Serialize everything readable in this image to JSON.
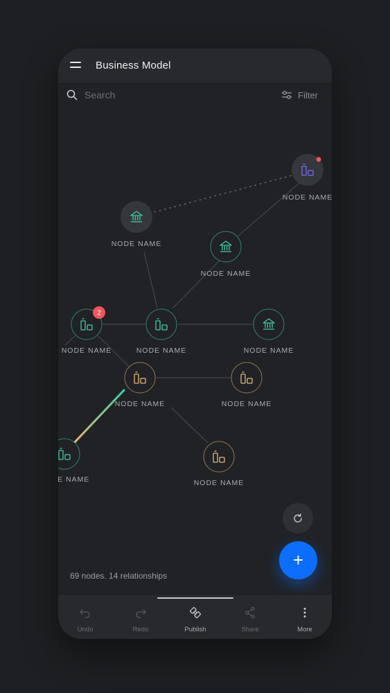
{
  "app": {
    "title": "Business Model"
  },
  "search": {
    "placeholder": "Search"
  },
  "filter": {
    "label": "Filter"
  },
  "nodes": [
    {
      "id": "n1",
      "label": "NODE NAME",
      "icon": "product-icon",
      "color": "#7a6cf0",
      "badge": "dot"
    },
    {
      "id": "n2",
      "label": "NODE NAME",
      "icon": "bank-icon",
      "color": "#3ecfa6"
    },
    {
      "id": "n3",
      "label": "NODE NAME",
      "icon": "bank-icon",
      "color": "#3ecfa6"
    },
    {
      "id": "n4",
      "label": "NODE NAME",
      "icon": "product-icon",
      "color": "#3ecfa6",
      "badge": "2"
    },
    {
      "id": "n5",
      "label": "NODE NAME",
      "icon": "product-icon",
      "color": "#3ecfa6"
    },
    {
      "id": "n6",
      "label": "NODE NAME",
      "icon": "bank-icon",
      "color": "#3ecfa6"
    },
    {
      "id": "n7",
      "label": "NODE NAME",
      "icon": "product-icon",
      "color": "#e2b876"
    },
    {
      "id": "n8",
      "label": "NODE NAME",
      "icon": "product-icon",
      "color": "#e2b876"
    },
    {
      "id": "n9",
      "label": "NODE NAME",
      "icon": "product-icon",
      "color": "#3ecfa6"
    },
    {
      "id": "n10",
      "label": "NODE NAME",
      "icon": "product-icon",
      "color": "#e2b876"
    }
  ],
  "stats": {
    "text": "69 nodes. 14 relationships"
  },
  "toolbar": {
    "items": [
      {
        "label": "Undo",
        "icon": "undo-icon",
        "enabled": false
      },
      {
        "label": "Redo",
        "icon": "redo-icon",
        "enabled": false
      },
      {
        "label": "Publish",
        "icon": "publish-icon",
        "enabled": true
      },
      {
        "label": "Share",
        "icon": "share-icon",
        "enabled": false
      },
      {
        "label": "More",
        "icon": "more-vertical-icon",
        "enabled": true
      }
    ]
  },
  "colors": {
    "accent": "#0d6efd",
    "badge": "#f2545b",
    "teal": "#3ecfa6",
    "gold": "#e2b876",
    "purple": "#7a6cf0"
  }
}
